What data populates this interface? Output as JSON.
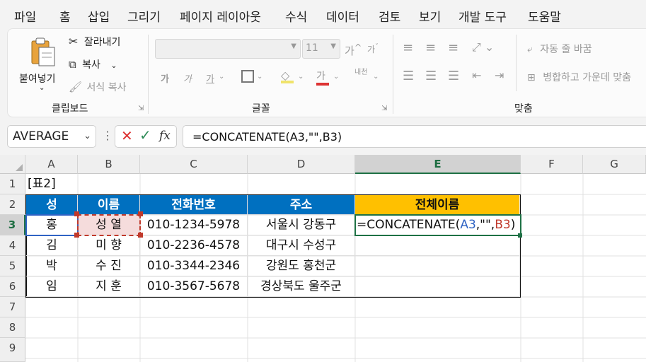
{
  "menu": [
    "파일",
    "홈",
    "삽입",
    "그리기",
    "페이지 레이아웃",
    "수식",
    "데이터",
    "검토",
    "보기",
    "개발 도구",
    "도움말"
  ],
  "ribbon": {
    "clipboard": {
      "paste": "붙여넣기",
      "cut": "잘라내기",
      "copy": "복사",
      "format_painter": "서식 복사",
      "label": "클립보드"
    },
    "font": {
      "size": "11",
      "grow": "가",
      "shrink": "가",
      "bold": "가",
      "italic": "가",
      "underline": "가",
      "font_color_glyph": "가",
      "phonetic": "내천",
      "label": "글꼴"
    },
    "alignment": {
      "wrap": "자동 줄 바꿈",
      "merge": "병합하고 가운데 맞춤",
      "label": "맞춤"
    }
  },
  "formula_bar": {
    "name_box": "AVERAGE",
    "fx": "fx",
    "formula": "=CONCATENATE(A3,\"\",B3)"
  },
  "columns": [
    "A",
    "B",
    "C",
    "D",
    "E",
    "F",
    "G"
  ],
  "rows": [
    "1",
    "2",
    "3",
    "4",
    "5",
    "6",
    "7",
    "8",
    "9"
  ],
  "sheet": {
    "title_cell": "[표2]",
    "headers": [
      "성",
      "이름",
      "전화번호",
      "주소",
      "전체이름"
    ],
    "data": [
      [
        "홍",
        "성 열",
        "010-1234-5978",
        "서울시 강동구"
      ],
      [
        "김",
        "미 향",
        "010-2236-4578",
        "대구시 수성구"
      ],
      [
        "박",
        "수 진",
        "010-3344-2346",
        "강원도 홍천군"
      ],
      [
        "임",
        "지 훈",
        "010-3567-5678",
        "경상북도 울주군"
      ]
    ],
    "edit_cell": {
      "prefix": "=CONCATENATE(",
      "ref1": "A3",
      "mid": ",\"\",",
      "ref2": "B3",
      "suffix": ")"
    }
  },
  "colors": {
    "accent": "#1e7145",
    "header_blue": "#0070c0",
    "header_gold": "#ffc000",
    "ref_blue": "#2f63c4",
    "ref_red": "#c0392b"
  }
}
